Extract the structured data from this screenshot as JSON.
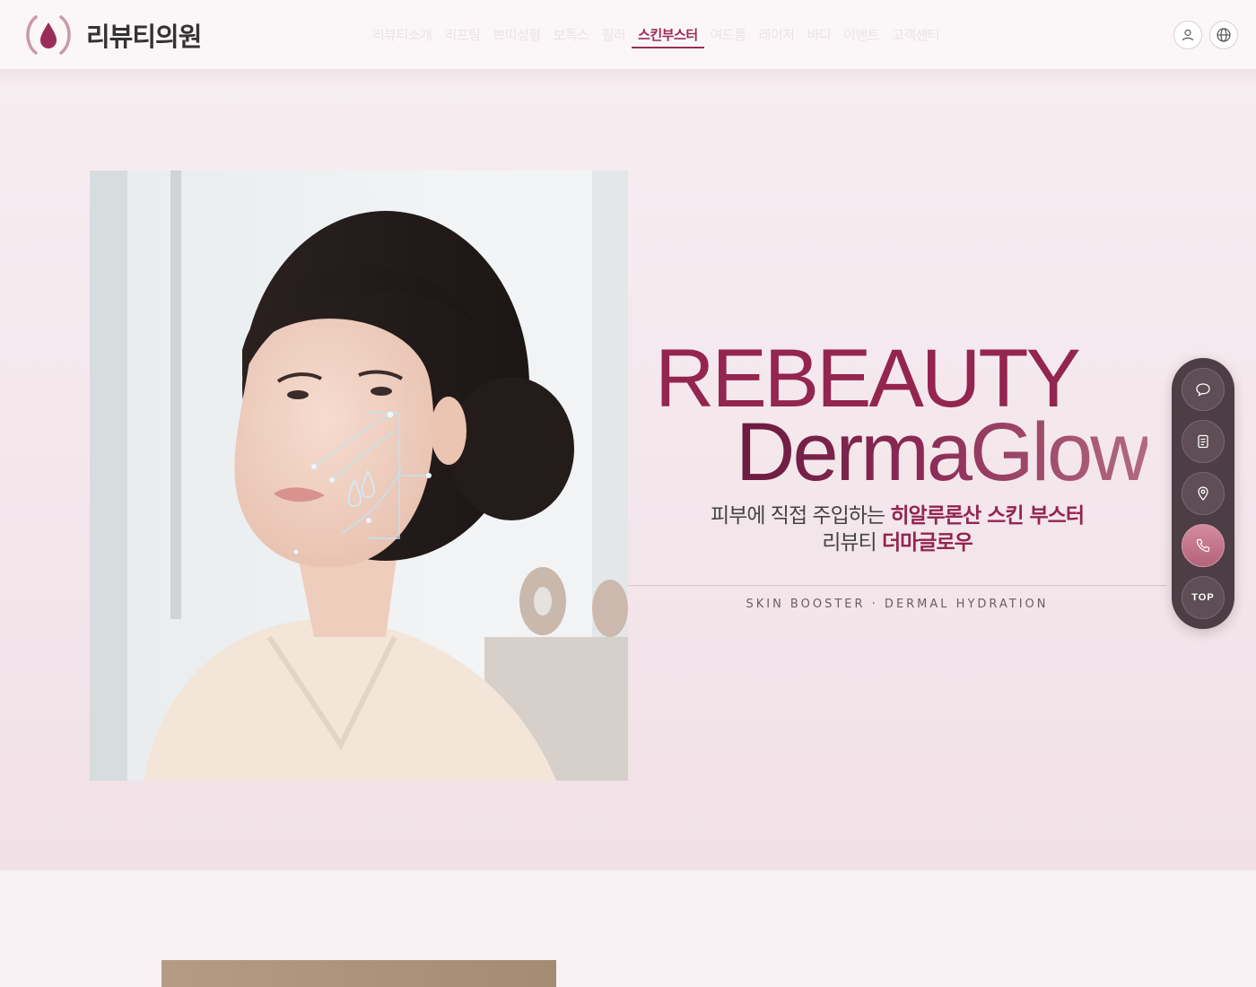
{
  "logo": {
    "text": "리뷰티의원"
  },
  "nav": {
    "items": [
      {
        "label": "리뷰티소개"
      },
      {
        "label": "리프팅"
      },
      {
        "label": "쁘띠성형"
      },
      {
        "label": "보톡스"
      },
      {
        "label": "필러"
      },
      {
        "label": "스킨부스터",
        "active": true
      },
      {
        "label": "여드름"
      },
      {
        "label": "레이저"
      },
      {
        "label": "바디"
      },
      {
        "label": "이벤트"
      },
      {
        "label": "고객센터"
      }
    ]
  },
  "hero": {
    "title_line1": "REBEAUTY",
    "title_line2": "DermaGlow",
    "sub_line1_plain": "피부에 직접 주입하는 ",
    "sub_line1_strong": "히알루론산 스킨 부스터",
    "sub_line2_plain": "리뷰티 ",
    "sub_line2_strong": "더마글로우",
    "caption": "SKIN BOOSTER · DERMAL HYDRATION"
  },
  "quick_menu": {
    "top_label": "TOP",
    "icons": [
      "chat-icon",
      "document-icon",
      "location-icon",
      "phone-icon"
    ]
  },
  "colors": {
    "brand": "#93254f",
    "header_bg": "#fbf6f8",
    "hero_bg": "#f3e5ea",
    "quick_bg": "#4d3d44",
    "call_accent": "#c8788f"
  }
}
